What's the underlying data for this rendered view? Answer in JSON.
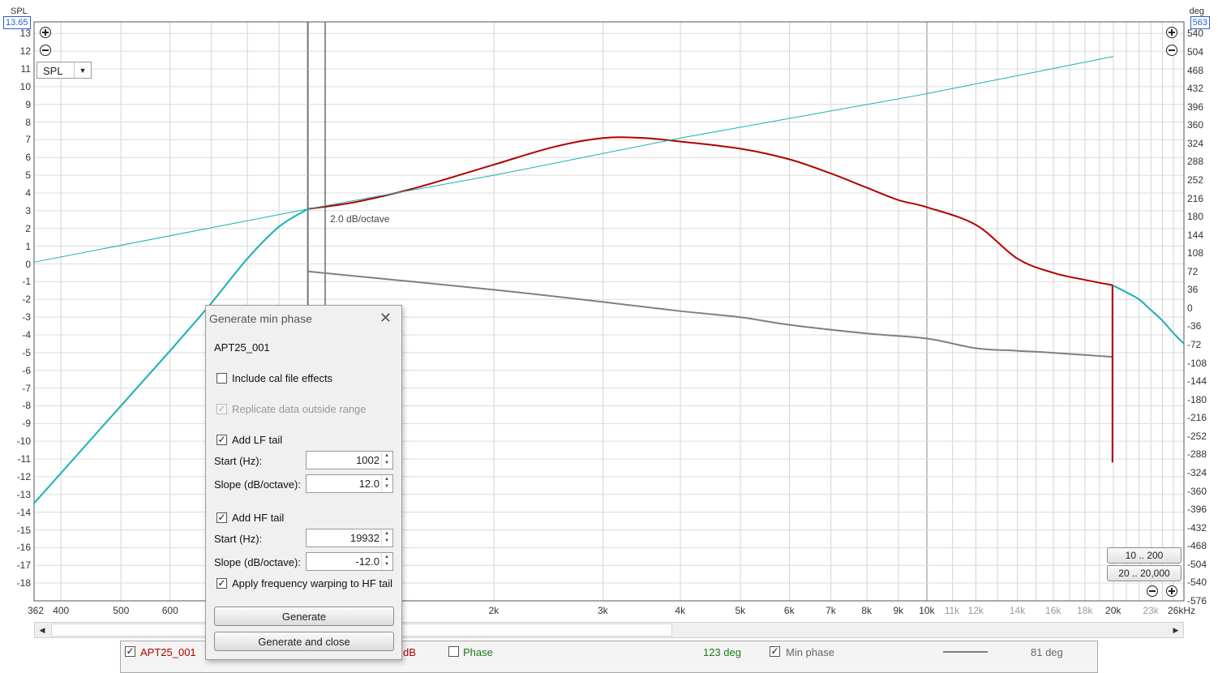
{
  "axes": {
    "left_unit": "SPL",
    "left_value": "13.65",
    "right_unit": "deg",
    "right_value": "563",
    "left_ticks": [
      "13",
      "12",
      "11",
      "10",
      "9",
      "8",
      "7",
      "6",
      "5",
      "4",
      "3",
      "2",
      "1",
      "0",
      "-1",
      "-2",
      "-3",
      "-4",
      "-5",
      "-6",
      "-7",
      "-8",
      "-9",
      "-10",
      "-11",
      "-12",
      "-13",
      "-14",
      "-15",
      "-16",
      "-17",
      "-18"
    ],
    "right_ticks": [
      "540",
      "504",
      "468",
      "432",
      "396",
      "360",
      "324",
      "288",
      "252",
      "216",
      "180",
      "144",
      "108",
      "72",
      "36",
      "0",
      "-36",
      "-72",
      "-108",
      "-144",
      "-180",
      "-216",
      "-252",
      "-288",
      "-324",
      "-360",
      "-396",
      "-432",
      "-468",
      "-504",
      "-540",
      "-576"
    ],
    "x_ticks_major": [
      "362",
      "400",
      "500",
      "600",
      "2k",
      "3k",
      "4k",
      "5k",
      "6k",
      "7k",
      "8k",
      "9k",
      "10k",
      "20k",
      "26kHz"
    ],
    "x_ticks_minor": [
      "11k",
      "12k",
      "14k",
      "16k",
      "18k",
      "23k"
    ]
  },
  "graph_dropdown": {
    "value": "SPL"
  },
  "annotation": "2.0 dB/octave",
  "range_buttons": {
    "b1": "10 .. 200",
    "b2": "20 .. 20,000"
  },
  "colors": {
    "spl": "#b00000",
    "min_phase": "#808080",
    "tail": "#1ab0b0",
    "accent": "#2a5bd7"
  },
  "dialog": {
    "title": "Generate min phase",
    "measurement": "APT25_001",
    "include_cal": {
      "label": "Include cal file effects",
      "checked": false
    },
    "replicate": {
      "label": "Replicate data outside range",
      "checked": true,
      "disabled": true
    },
    "lf_tail": {
      "label": "Add LF tail",
      "checked": true,
      "start_label": "Start (Hz):",
      "start": "1002",
      "slope_label": "Slope (dB/octave):",
      "slope": "12.0"
    },
    "hf_tail": {
      "label": "Add HF tail",
      "checked": true,
      "start_label": "Start (Hz):",
      "start": "19932",
      "slope_label": "Slope (dB/octave):",
      "slope": "-12.0"
    },
    "warping": {
      "label": "Apply frequency warping to HF tail",
      "checked": true
    },
    "generate": "Generate",
    "generate_close": "Generate and close"
  },
  "legend": {
    "name": "APT25_001",
    "unit": "dB",
    "phase_label": "Phase",
    "phase_value": "123 deg",
    "min_phase_label": "Min phase",
    "min_phase_value": "81 deg"
  },
  "chart_data": {
    "type": "line",
    "x_scale": "log",
    "xlim": [
      362,
      26000
    ],
    "ylim_left": [
      -19,
      13.65
    ],
    "ylim_right": [
      -576,
      563
    ],
    "series": [
      {
        "name": "APT25_001",
        "axis": "left",
        "x": [
          1002,
          1200,
          1500,
          2000,
          2500,
          3000,
          3500,
          4000,
          5000,
          6000,
          7000,
          8000,
          9000,
          10000,
          12000,
          14000,
          16000,
          18000,
          19932
        ],
        "values": [
          3.1,
          3.5,
          4.3,
          5.6,
          6.6,
          7.1,
          7.1,
          6.9,
          6.5,
          5.9,
          5.1,
          4.3,
          3.6,
          3.2,
          2.2,
          0.3,
          -0.5,
          -0.9,
          -1.2
        ]
      },
      {
        "axis": "left",
        "x": [
          362,
          500,
          600,
          700,
          800,
          900,
          1002
        ],
        "values": [
          -13.5,
          -8.0,
          -4.9,
          -2.2,
          0.3,
          2.1,
          3.1
        ]
      },
      {
        "axis": "left",
        "x": [
          362,
          1002,
          2000,
          4000,
          10000,
          20000
        ],
        "values": [
          0.1,
          3.1,
          5.0,
          7.1,
          9.6,
          11.7
        ]
      },
      {
        "axis": "left",
        "x": [
          19932,
          21000,
          22000,
          23000,
          24000,
          25000,
          26000
        ],
        "values": [
          -1.2,
          -1.6,
          -2.0,
          -2.6,
          -3.2,
          -3.9,
          -4.5
        ]
      },
      {
        "name": "Min phase",
        "axis": "right",
        "x": [
          1002,
          2000,
          3000,
          4000,
          5000,
          6000,
          8000,
          10000,
          12000,
          14000,
          16000,
          19932
        ],
        "values": [
          72,
          36,
          12,
          -6,
          -18,
          -33,
          -50,
          -60,
          -79,
          -84,
          -88,
          -96
        ]
      }
    ]
  }
}
